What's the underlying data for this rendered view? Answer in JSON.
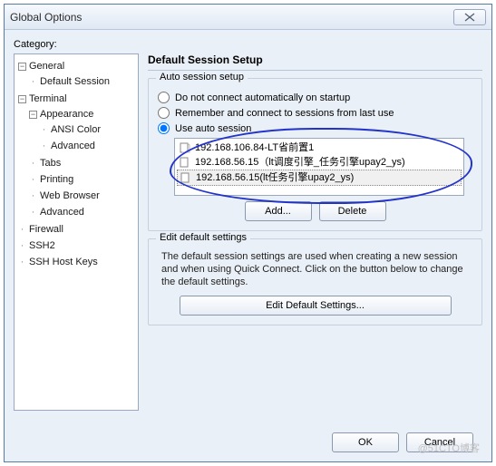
{
  "window": {
    "title": "Global Options"
  },
  "category_label": "Category:",
  "tree": {
    "general": "General",
    "default_session": "Default Session",
    "terminal": "Terminal",
    "appearance": "Appearance",
    "ansi_color": "ANSI Color",
    "advanced1": "Advanced",
    "tabs": "Tabs",
    "printing": "Printing",
    "web_browser": "Web Browser",
    "advanced2": "Advanced",
    "firewall": "Firewall",
    "ssh2": "SSH2",
    "ssh_host_keys": "SSH Host Keys"
  },
  "right": {
    "title": "Default Session Setup",
    "auto_group": "Auto session setup",
    "opt_none": "Do not connect automatically on startup",
    "opt_remember": "Remember and connect to sessions from last use",
    "opt_use": "Use auto session",
    "sessions": [
      "192.168.106.84-LT省前置1",
      "192.168.56.15（lt调度引擎_任务引擎upay2_ys)",
      "192.168.56.15(lt任务引擎upay2_ys)"
    ],
    "add": "Add...",
    "delete": "Delete",
    "edit_group": "Edit default settings",
    "edit_help": "The default session settings are used when creating a new session and when using Quick Connect.  Click on the button below to change the default settings.",
    "edit_btn": "Edit Default Settings..."
  },
  "footer": {
    "ok": "OK",
    "cancel": "Cancel"
  },
  "watermark": "@51CTO博客"
}
